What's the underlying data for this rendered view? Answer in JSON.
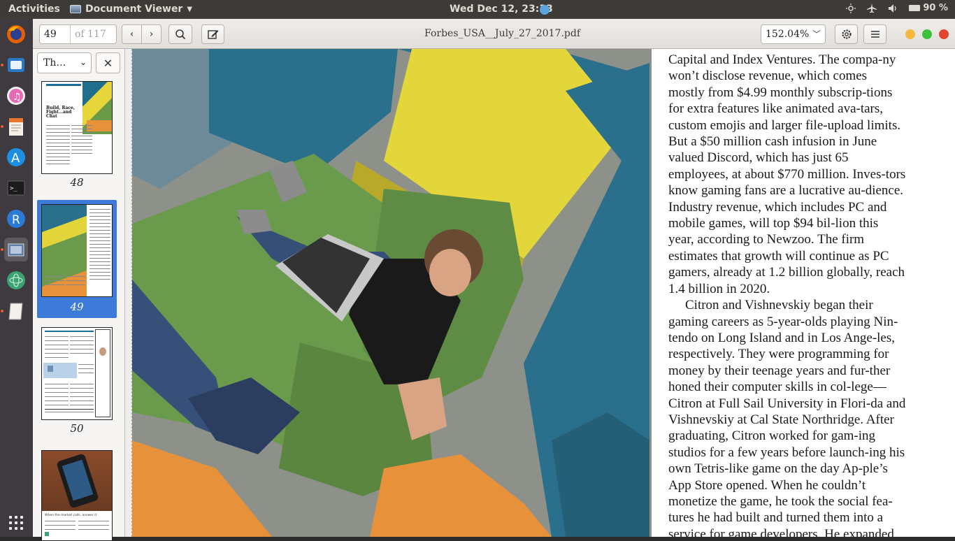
{
  "topbar": {
    "activities": "Activities",
    "app_name": "Document Viewer",
    "clock": "Wed Dec 12, 23:33",
    "battery": "90 %"
  },
  "launcher": {
    "items": [
      "firefox-icon",
      "files-icon",
      "music-icon",
      "text-editor-icon",
      "app-store-icon",
      "terminal-icon",
      "r-icon",
      "document-viewer-icon",
      "atom-icon",
      "notes-icon"
    ]
  },
  "toolbar": {
    "page_current": "49",
    "page_of": "of 117",
    "doc_title": "Forbes_USA__July_27_2017.pdf",
    "zoom": "152.04%"
  },
  "sidebar": {
    "mode": "Th…",
    "thumbs": [
      {
        "num": "48",
        "headline": "Build, Race, Fight…and Chat"
      },
      {
        "num": "49"
      },
      {
        "num": "50"
      },
      {
        "caption": "When the market calls, answer it"
      }
    ]
  },
  "article": {
    "paragraphs": [
      "Capital and Index Ventures. The compa-ny won’t disclose revenue, which comes mostly from $4.99 monthly subscrip-tions for extra features like animated ava-tars, custom emojis and larger file-upload limits. But a $50 million cash infusion in June valued Discord, which has just 65 employees, at about $770 million. Inves-tors know gaming fans are a lucrative au-dience. Industry revenue, which includes PC and mobile games, will top $94 bil-lion this year, according to Newzoo. The firm estimates that growth will continue as PC gamers, already at 1.2 billion globally, reach 1.4 billion in 2020.",
      "Citron and Vishnevskiy began their gaming careers as 5-year-olds playing Nin-tendo on Long Island and in Los Ange-les, respectively. They were programming for money by their teenage years and fur-ther honed their computer skills in col-lege—Citron at Full Sail University in Flori-da and Vishnevskiy at Cal State Northridge. After graduating, Citron worked for gam-ing studios for a few years before launch-ing his own Tetris-like game on the day Ap-ple’s App Store opened. When he couldn’t monetize the game, he took the social fea-tures he had built and turned them into a service for game developers. He expanded"
    ]
  },
  "colors": {
    "topbar": "#3c3b37",
    "launcher": "#3e3a3f",
    "selection": "#3d7ad9"
  }
}
